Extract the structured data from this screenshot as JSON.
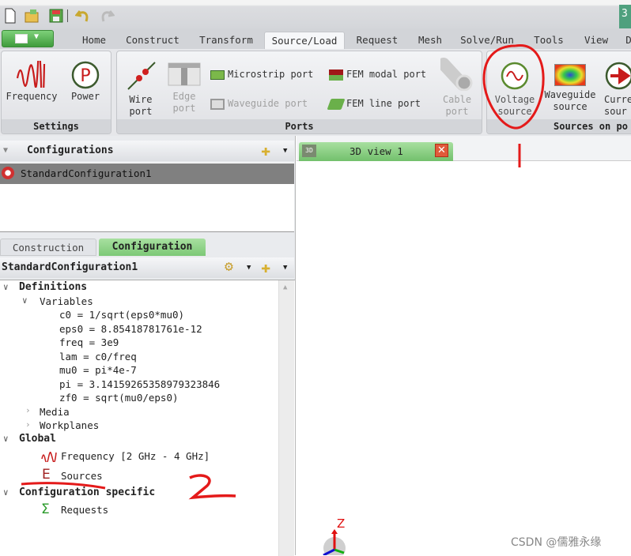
{
  "quick_access": {
    "icons": [
      "new-file-icon",
      "open-folder-icon",
      "save-icon",
      "undo-icon",
      "redo-icon"
    ],
    "corner_label": "3"
  },
  "menu_tabs": [
    "Home",
    "Construct",
    "Transform",
    "Source/Load",
    "Request",
    "Mesh",
    "Solve/Run",
    "Tools",
    "View",
    "D"
  ],
  "active_tab": "Source/Load",
  "ribbon": {
    "settings": {
      "label": "Settings",
      "buttons": [
        "Frequency",
        "Power"
      ]
    },
    "ports": {
      "label": "Ports",
      "wire": [
        "Wire",
        "port"
      ],
      "edge": [
        "Edge",
        "port"
      ],
      "microstrip": "Microstrip port",
      "waveguide": "Waveguide port",
      "fem_modal": "FEM modal port",
      "fem_line": "FEM line port",
      "cable": [
        "Cable",
        "port"
      ]
    },
    "sources": {
      "label": "Sources on po",
      "voltage": [
        "Voltage",
        "source"
      ],
      "waveguide": [
        "Waveguide",
        "source"
      ],
      "current": [
        "Curre",
        "sour"
      ]
    }
  },
  "configurations": {
    "title": "Configurations",
    "items": [
      "StandardConfiguration1"
    ]
  },
  "left_tabs": [
    "Construction",
    "Configuration"
  ],
  "active_left_tab": "Configuration",
  "config_header": "StandardConfiguration1",
  "tree": {
    "definitions": "Definitions",
    "variables": "Variables",
    "vars": [
      "c0 = 1/sqrt(eps0*mu0)",
      "eps0 = 8.85418781761e-12",
      "freq = 3e9",
      "lam = c0/freq",
      "mu0 = pi*4e-7",
      "pi = 3.14159265358979323846",
      "zf0 = sqrt(mu0/eps0)"
    ],
    "media": "Media",
    "workplanes": "Workplanes",
    "global": "Global",
    "frequency": "Frequency [2 GHz - 4 GHz]",
    "sources": "Sources",
    "config_specific": "Configuration specific",
    "requests": "Requests"
  },
  "view_tab": {
    "label": "3D view 1",
    "badge": "3D"
  },
  "axes": {
    "z": "Z"
  },
  "annotations": {
    "one": "1",
    "two": "2",
    "color": "#e41a1a"
  },
  "watermark": "CSDN @儒雅永缘",
  "colors": {
    "accent_green": "#5cb85a",
    "selected_row": "#808080"
  }
}
